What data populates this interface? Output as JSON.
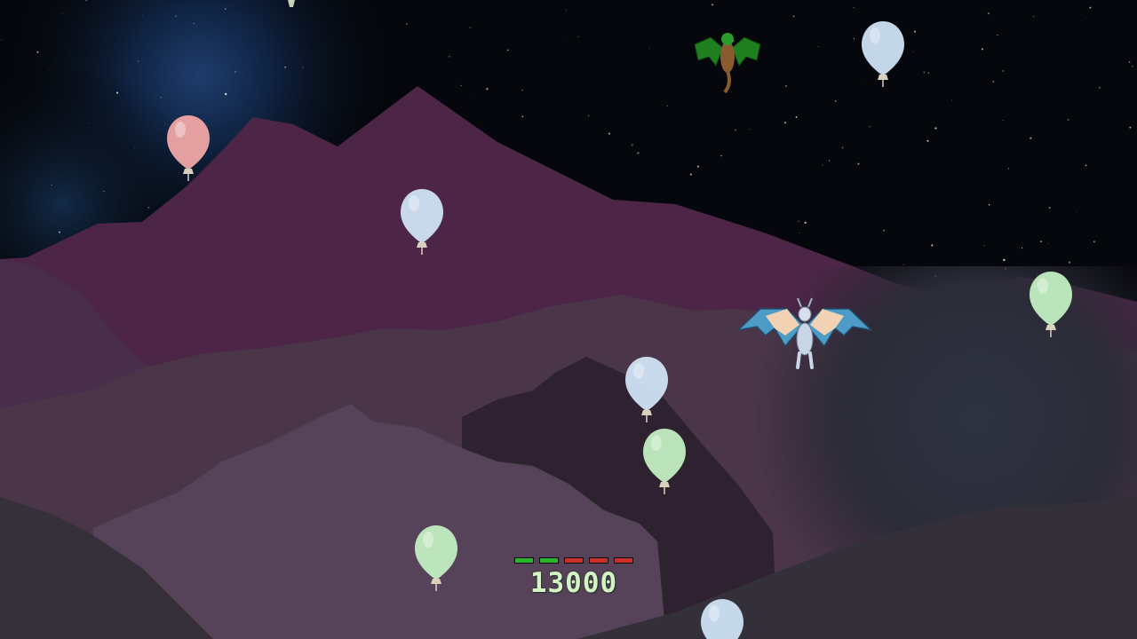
{
  "hud": {
    "score": "13000",
    "health": {
      "total": 5,
      "remaining": 2,
      "colors": {
        "full": "#2db62d",
        "empty": "#c9302c"
      }
    }
  },
  "entities": {
    "player": {
      "type": "blue-dragon"
    },
    "enemies": [
      {
        "type": "green-dragon"
      }
    ],
    "balloons": [
      {
        "name": "balloon-pink",
        "color": "pink"
      },
      {
        "name": "balloon-blue-sky-right",
        "color": "blue"
      },
      {
        "name": "balloon-blue-mid",
        "color": "blue"
      },
      {
        "name": "balloon-green-right",
        "color": "green"
      },
      {
        "name": "balloon-blue-center",
        "color": "blue"
      },
      {
        "name": "balloon-green-center",
        "color": "green"
      },
      {
        "name": "balloon-green-bottom-left",
        "color": "green"
      },
      {
        "name": "balloon-blue-bottom",
        "color": "blue"
      }
    ]
  },
  "palette": {
    "pink": "#f0a7a7",
    "blue": "#cfe3f4",
    "green": "#c2eec1",
    "sky": "#05070c",
    "mountain_far": "#4e2748"
  }
}
